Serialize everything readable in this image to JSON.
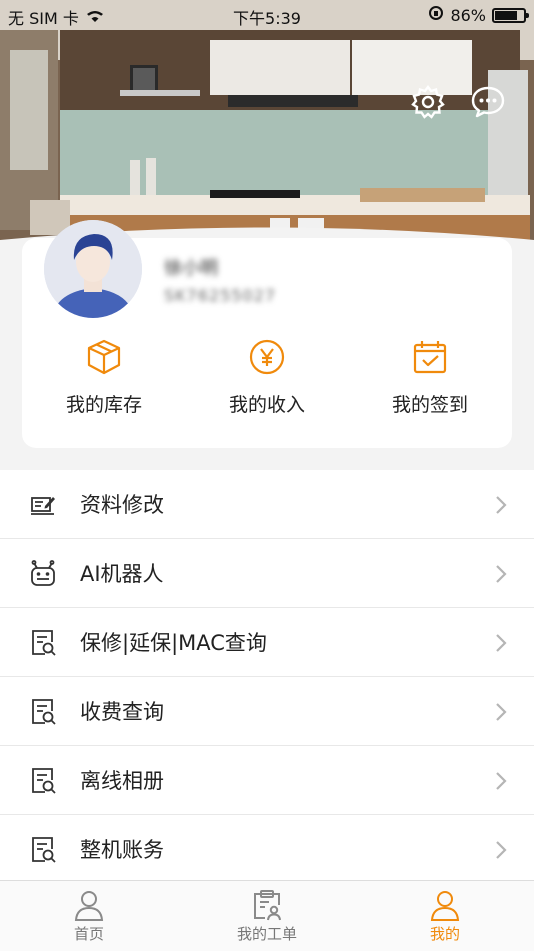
{
  "status_bar": {
    "carrier": "无 SIM 卡",
    "time": "下午5:39",
    "battery_percent": "86%",
    "battery_level": 0.86
  },
  "header": {
    "settings_icon": "gear-icon",
    "message_icon": "chat-bubble-icon"
  },
  "profile": {
    "name": "徐小明",
    "user_id": "SK76255027"
  },
  "quick_actions": [
    {
      "label": "我的库存",
      "icon": "box-icon"
    },
    {
      "label": "我的收入",
      "icon": "yen-coin-icon"
    },
    {
      "label": "我的签到",
      "icon": "calendar-check-icon"
    }
  ],
  "menu": [
    {
      "label": "资料修改",
      "icon": "edit-profile-icon"
    },
    {
      "label": "AI机器人",
      "icon": "robot-icon"
    },
    {
      "label": "保修|延保|MAC查询",
      "icon": "document-search-icon"
    },
    {
      "label": "收费查询",
      "icon": "document-search-icon"
    },
    {
      "label": "离线相册",
      "icon": "document-search-icon"
    },
    {
      "label": "整机账务",
      "icon": "document-search-icon"
    }
  ],
  "tabs": [
    {
      "label": "首页",
      "icon": "person-icon",
      "active": false
    },
    {
      "label": "我的工单",
      "icon": "clipboard-person-icon",
      "active": false
    },
    {
      "label": "我的",
      "icon": "person-icon",
      "active": true
    }
  ],
  "colors": {
    "accent": "#f08a0c",
    "text": "#222222",
    "background": "#f3f3f3"
  }
}
